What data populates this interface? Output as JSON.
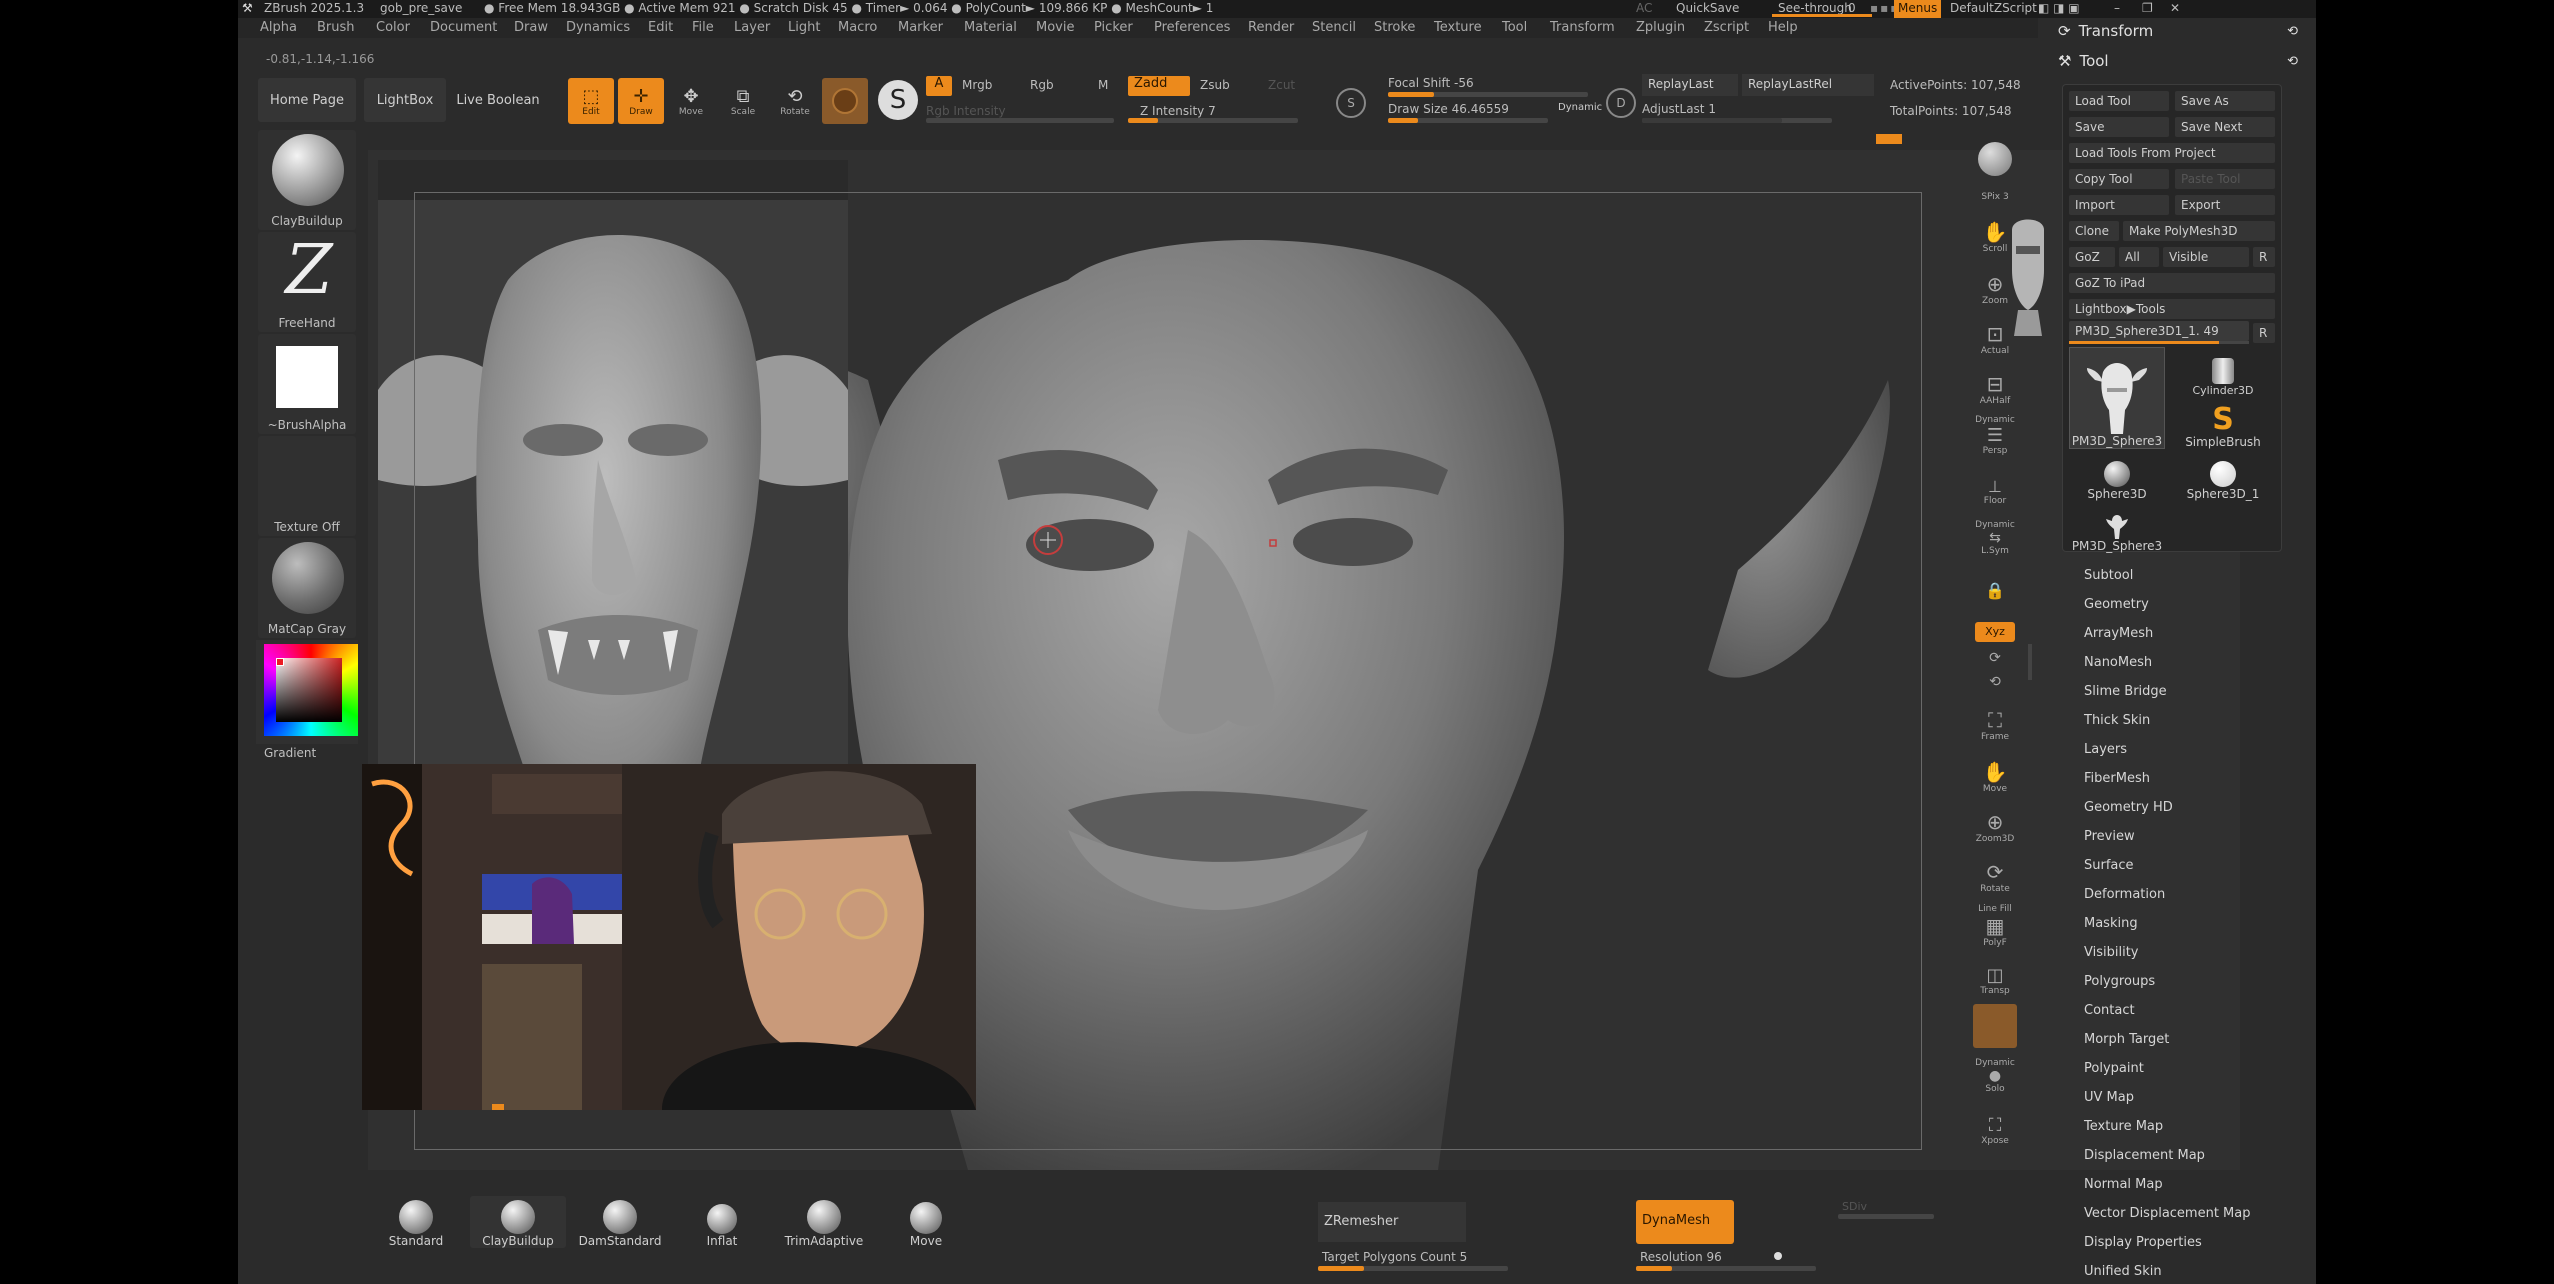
{
  "titlebar": {
    "app": "ZBrush 2025.1.3",
    "file": "gob_pre_save",
    "stats": "● Free Mem 18.943GB ● Active Mem 921 ● Scratch Disk 45 ● Timer► 0.064 ● PolyCount► 109.866 KP ● MeshCount► 1",
    "ac": "AC",
    "quicksave": "QuickSave",
    "see_through": "See-through",
    "see_through_value": "0",
    "menus": "Menus",
    "script": "DefaultZScript"
  },
  "menubar": [
    "Alpha",
    "Brush",
    "Color",
    "Document",
    "Draw",
    "Dynamics",
    "Edit",
    "File",
    "Layer",
    "Light",
    "Macro",
    "Marker",
    "Material",
    "Movie",
    "Picker",
    "Preferences",
    "Render",
    "Stencil",
    "Stroke",
    "Texture",
    "Tool",
    "Transform",
    "Zplugin",
    "Zscript",
    "Help"
  ],
  "coords": "-0.81,-1.14,-1.166",
  "toolbar": {
    "home_page": "Home Page",
    "lightbox": "LightBox",
    "live_boolean": "Live Boolean",
    "edit": "Edit",
    "draw": "Draw",
    "move": "Move",
    "scale": "Scale",
    "rotate": "Rotate",
    "a": "A",
    "mrgb": "Mrgb",
    "rgb": "Rgb",
    "m": "M",
    "rgb_intensity": "Rgb Intensity",
    "zadd": "Zadd",
    "zsub": "Zsub",
    "zcut": "Zcut",
    "z_intensity": "Z Intensity 7",
    "focal_shift": "Focal Shift -56",
    "draw_size": "Draw Size 46.46559",
    "dynamic": "Dynamic",
    "replay_last": "ReplayLast",
    "replay_last_rel": "ReplayLastRel",
    "adjust_last": "AdjustLast 1",
    "active_points": "ActivePoints: 107,548",
    "total_points": "TotalPoints: 107,548"
  },
  "shelf": {
    "brush": "ClayBuildup",
    "stroke": "FreeHand",
    "alpha": "~BrushAlpha",
    "texture": "Texture Off",
    "material": "MatCap Gray",
    "gradient": "Gradient"
  },
  "right_strip": {
    "bpr": "BPR",
    "spix": "SPix 3",
    "scroll": "Scroll",
    "zoom": "Zoom",
    "actual": "Actual",
    "aahalf": "AAHalf",
    "dynamic_persp": "Dynamic",
    "persp": "Persp",
    "floor": "Floor",
    "dynamic_lsym": "Dynamic",
    "lsym": "L.Sym",
    "xyz": "Xyz",
    "frame": "Frame",
    "move": "Move",
    "zoom3d": "Zoom3D",
    "rotate": "Rotate",
    "line_fill": "Line Fill",
    "polyf": "PolyF",
    "transp": "Transp",
    "ghost": "Ghost",
    "dynamic_solo": "Dynamic",
    "solo": "Solo",
    "xpose": "Xpose"
  },
  "palette": {
    "transform": "Transform",
    "tool": "Tool",
    "load_tool": "Load Tool",
    "save_as": "Save As",
    "save": "Save",
    "save_next": "Save Next",
    "load_tools_from_project": "Load Tools From Project",
    "copy_tool": "Copy Tool",
    "paste_tool": "Paste Tool",
    "import": "Import",
    "export": "Export",
    "clone": "Clone",
    "make_polymesh": "Make PolyMesh3D",
    "goz": "GoZ",
    "all": "All",
    "visible": "Visible",
    "r": "R",
    "goz_to_ipad": "GoZ To iPad",
    "lightbox_tools": "Lightbox▶Tools",
    "current_tool": "PM3D_Sphere3D1_1. 49",
    "thumbs": [
      "PM3D_Sphere3",
      "SimpleBrush",
      "Sphere3D",
      "Sphere3D_1",
      "PM3D_Sphere3"
    ],
    "cylinder": "Cylinder3D",
    "sections": [
      "Subtool",
      "Geometry",
      "ArrayMesh",
      "NanoMesh",
      "Slime Bridge",
      "Thick Skin",
      "Layers",
      "FiberMesh",
      "Geometry HD",
      "Preview",
      "Surface",
      "Deformation",
      "Masking",
      "Visibility",
      "Polygroups",
      "Contact",
      "Morph Target",
      "Polypaint",
      "UV Map",
      "Texture Map",
      "Displacement Map",
      "Normal Map",
      "Vector Displacement Map",
      "Display Properties",
      "Unified Skin"
    ]
  },
  "bottom": {
    "brushes": [
      "Standard",
      "ClayBuildup",
      "DamStandard",
      "Inflat",
      "TrimAdaptive",
      "Move"
    ],
    "zremesher": "ZRemesher",
    "target_polygons": "Target Polygons Count 5",
    "dynamesh": "DynaMesh",
    "resolution": "Resolution 96",
    "sdiv": "SDiv"
  }
}
